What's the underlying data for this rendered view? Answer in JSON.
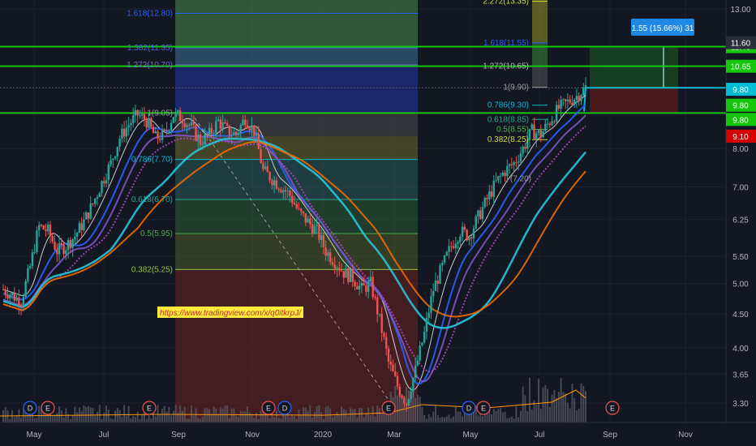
{
  "chart_data": {
    "type": "candlestick",
    "title": "",
    "price_axis": {
      "scale": "log",
      "ticks": [
        "13.00",
        "7.00",
        "6.25",
        "5.50",
        "5.00",
        "4.50",
        "4.00",
        "3.65",
        "3.30",
        "8.00"
      ],
      "tick_values": [
        13.0,
        7.0,
        6.25,
        5.5,
        5.0,
        4.5,
        4.0,
        3.65,
        3.3,
        8.0
      ]
    },
    "time_axis": {
      "labels": [
        "May",
        "Jul",
        "Sep",
        "Nov",
        "2020",
        "Mar",
        "May",
        "Jul",
        "Sep",
        "Nov"
      ]
    },
    "price_tags": [
      {
        "text": "11.40",
        "value": 11.4,
        "color": "#16c60c"
      },
      {
        "text": "10.65",
        "value": 10.65,
        "color": "#16c60c"
      },
      {
        "text": "9.80",
        "value": 9.83,
        "color": "#00bcd4"
      },
      {
        "text": "9.80",
        "value": 9.3,
        "color": "#16c60c"
      },
      {
        "text": "9.80",
        "value": 8.85,
        "color": "#16c60c"
      },
      {
        "text": "9.10",
        "value": 8.35,
        "color": "#d50000"
      },
      {
        "text": "11.60",
        "value": 11.56,
        "color": "#2a2e39"
      }
    ],
    "horizontal_lines": [
      {
        "value": 11.4,
        "color": "#16c60c"
      },
      {
        "value": 10.65,
        "color": "#16c60c"
      },
      {
        "value": 9.05,
        "color": "#16c60c"
      },
      {
        "value": 9.88,
        "color": "#5d606b",
        "dotted": true
      }
    ],
    "fib_left": {
      "levels": [
        {
          "label": "1.618(12.80)",
          "value": 12.8,
          "color": "#2962ff"
        },
        {
          "label": "1.382(11.35)",
          "value": 11.35,
          "color": "#4a6bd6"
        },
        {
          "label": "1.272(10.70)",
          "value": 10.7,
          "color": "#7b6bd0"
        },
        {
          "label": "1(9.05)",
          "value": 9.05,
          "color": "#9e9e9e"
        },
        {
          "label": "0.786(7.70)",
          "value": 7.7,
          "color": "#00bcd4"
        },
        {
          "label": "0.618(6.70)",
          "value": 6.7,
          "color": "#26a69a"
        },
        {
          "label": "0.5(5.95)",
          "value": 5.95,
          "color": "#4caf50"
        },
        {
          "label": "0.382(5.25)",
          "value": 5.25,
          "color": "#8bc34a"
        }
      ]
    },
    "fib_right": {
      "levels": [
        {
          "label": "2.272(13.35)",
          "value": 13.35,
          "color": "#cddc39"
        },
        {
          "label": "1.618(11.55)",
          "value": 11.55,
          "color": "#2962ff"
        },
        {
          "label": "1.272(10.65)",
          "value": 10.65,
          "color": "#b0b0b0"
        },
        {
          "label": "1(9.90)",
          "value": 9.9,
          "color": "#9e9e9e"
        },
        {
          "label": "0.786(9.30)",
          "value": 9.3,
          "color": "#00bcd4"
        },
        {
          "label": "0.618(8.85)",
          "value": 8.85,
          "color": "#26a69a"
        },
        {
          "label": "0.5(8.55)",
          "value": 8.55,
          "color": "#4caf50"
        },
        {
          "label": "0.382(8.25)",
          "value": 8.25,
          "color": "#cddc39"
        },
        {
          "label": "(7.20)",
          "value": 7.2,
          "color": "#9e9e9e"
        }
      ]
    },
    "position_tool": {
      "label": "1.55 (15.66%) 31",
      "entry": 9.88,
      "target": 11.4,
      "stop": 9.05
    },
    "event_markers": [
      {
        "glyph": "D",
        "month": "May",
        "offset": -0.1
      },
      {
        "glyph": "E",
        "month": "May",
        "offset": 0.15
      },
      {
        "glyph": "E",
        "month": "Sep",
        "offset": -0.35
      },
      {
        "glyph": "E",
        "month": "Nov",
        "offset": 0.2
      },
      {
        "glyph": "D",
        "month": "Nov",
        "offset": 0.4
      },
      {
        "glyph": "E",
        "month": "Mar",
        "offset": -0.05
      },
      {
        "glyph": "D",
        "month": "May",
        "offset": 2
      },
      {
        "glyph": "E",
        "month": "May",
        "offset": 2.2
      },
      {
        "glyph": "E",
        "month": "Sep",
        "offset": 2
      }
    ],
    "watermark_link": "https://www.tradingview.com/x/q0itkrpJ/",
    "series_close": [
      4.9,
      4.8,
      4.7,
      5.3,
      6.1,
      6.0,
      5.6,
      5.7,
      5.9,
      6.2,
      6.6,
      7.1,
      7.6,
      8.3,
      8.7,
      9.0,
      8.8,
      8.3,
      8.4,
      9.0,
      8.9,
      8.6,
      8.2,
      8.4,
      8.8,
      8.5,
      8.4,
      8.9,
      8.5,
      7.4,
      7.2,
      7.0,
      6.8,
      6.4,
      6.2,
      6.0,
      5.6,
      5.4,
      5.2,
      5.1,
      4.9,
      5.0,
      4.4,
      3.8,
      3.5,
      3.3,
      3.7,
      4.2,
      4.9,
      5.3,
      5.7,
      6.0,
      5.9,
      6.3,
      6.7,
      7.1,
      7.4,
      7.6,
      8.0,
      8.5,
      8.4,
      8.8,
      9.2,
      9.4,
      9.6,
      9.9
    ],
    "volume_note": ""
  }
}
